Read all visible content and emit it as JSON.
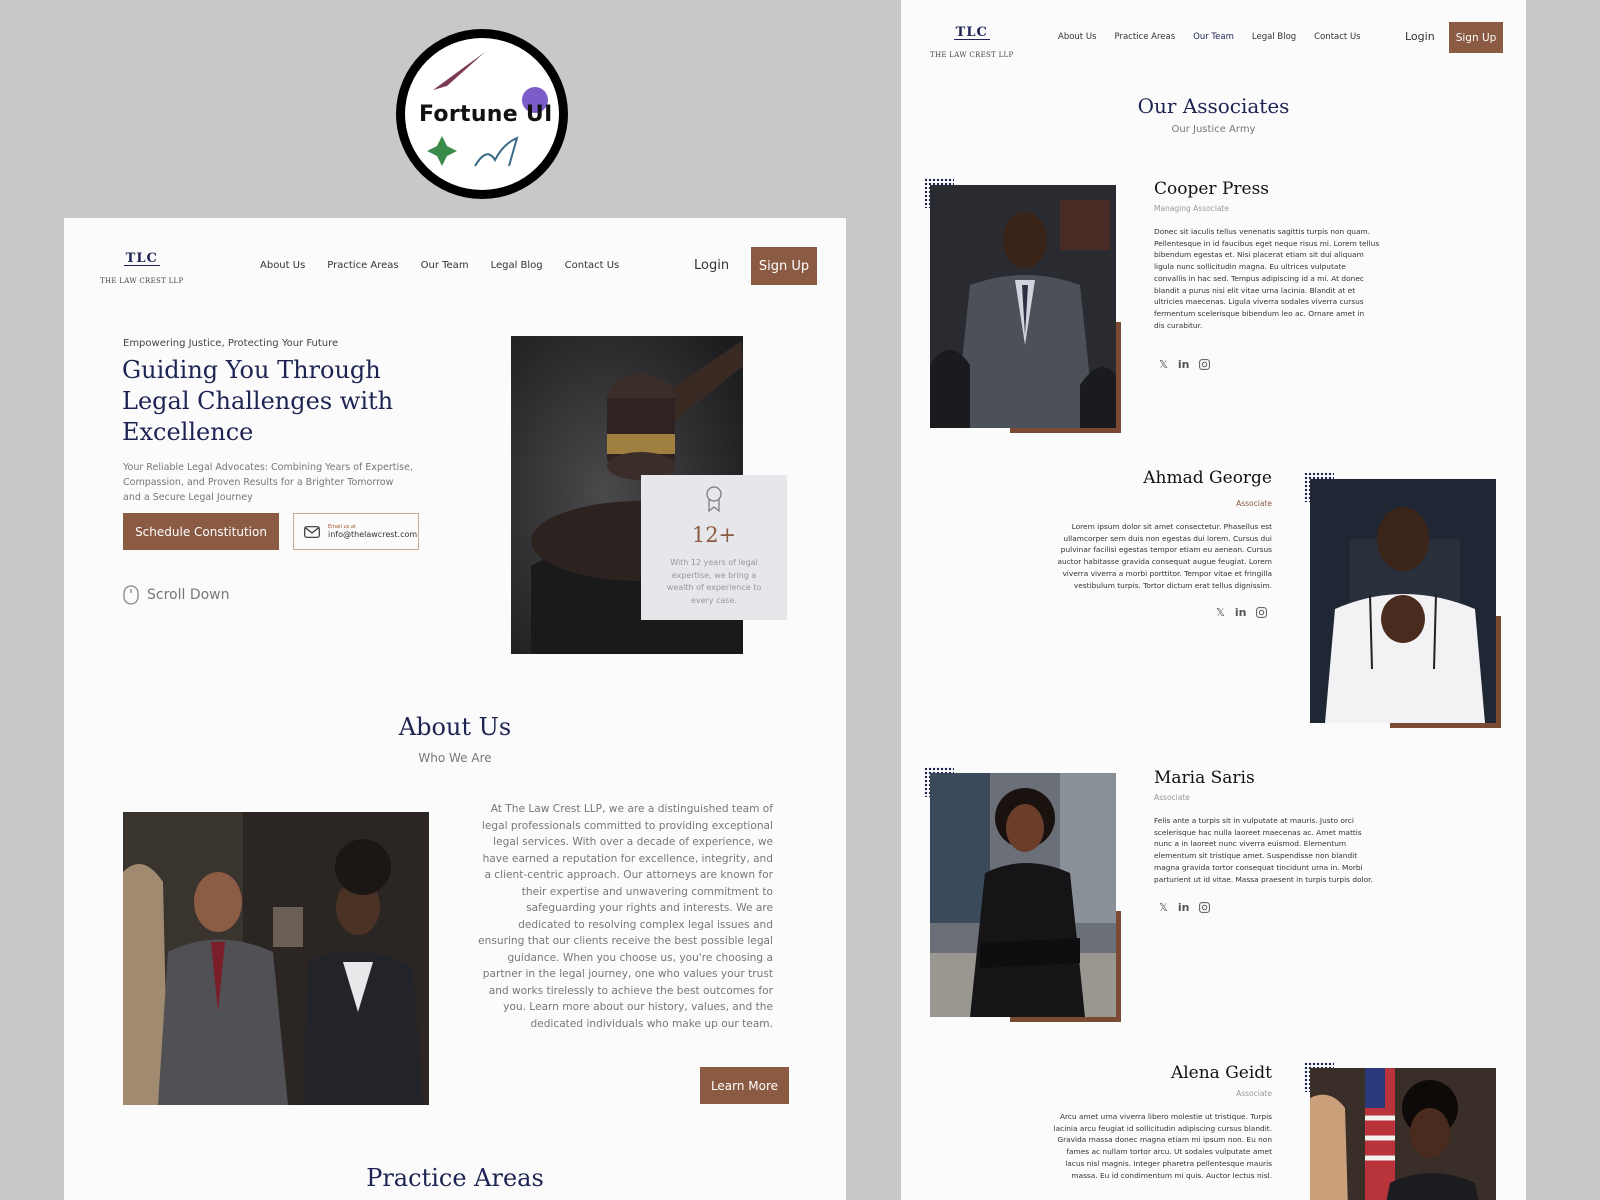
{
  "badge": {
    "text": "Fortune UI"
  },
  "left": {
    "logo": {
      "mono": "TLC",
      "firm": "THE LAW CREST LLP"
    },
    "nav": [
      "About Us",
      "Practice Areas",
      "Our Team",
      "Legal Blog",
      "Contact Us"
    ],
    "login": "Login",
    "signup": "Sign Up",
    "hero": {
      "eyebrow": "Empowering Justice, Protecting Your Future",
      "title_lines": [
        "Guiding You Through",
        "Legal Challenges with",
        "Excellence"
      ],
      "desc_lines": [
        "Your Reliable Legal Advocates: Combining Years of Expertise,",
        "Compassion, and Proven Results for a Brighter Tomorrow",
        "and a Secure Legal Journey"
      ],
      "cta": "Schedule Constitution",
      "email_label": "Email us at",
      "email": "info@thelawcrest.com",
      "scroll": "Scroll Down",
      "stat_value": "12+",
      "stat_lines": [
        "With 12 years of legal",
        "expertise, we bring a",
        "wealth of experience to",
        "every case."
      ]
    },
    "about": {
      "title": "About Us",
      "subtitle": "Who We Are",
      "lines": [
        "At The Law Crest LLP, we are a distinguished team of",
        "legal professionals committed to providing exceptional",
        "legal services. With over a decade of experience, we",
        "have earned a reputation for excellence, integrity, and",
        "a client-centric approach. Our attorneys are known for",
        "their expertise and unwavering commitment to",
        "safeguarding your rights and interests. We are",
        "dedicated to resolving complex legal issues and",
        "ensuring that our clients receive the best possible legal",
        "guidance. When you choose us, you're choosing a",
        "partner in the legal journey, one who values your trust",
        "and works tirelessly to achieve the best outcomes for",
        "you. Learn more about our history, values, and the",
        "dedicated individuals who make up our team."
      ],
      "button": "Learn More"
    },
    "practice_title": "Practice Areas"
  },
  "right": {
    "logo": {
      "mono": "TLC",
      "firm": "THE LAW CREST LLP"
    },
    "nav": [
      "About Us",
      "Practice Areas",
      "Our Team",
      "Legal Blog",
      "Contact Us"
    ],
    "login": "Login",
    "signup": "Sign Up",
    "title": "Our Associates",
    "subtitle": "Our Justice Army",
    "associates": [
      {
        "name": "Cooper Press",
        "role": "Managing Associate",
        "lines": [
          "Donec sit iaculis tellus venenatis sagittis turpis non quam.",
          "Pellentesque in id faucibus eget neque risus mi. Lorem tellus",
          "bibendum egestas et. Nisi placerat etiam sit dui aliquam",
          "ligula nunc sollicitudin magna. Eu ultrices vulputate",
          "convallis in hac sed. Tempus adipiscing id a mi. At donec",
          "blandit a purus nisi elit vitae urna lacinia. Blandit at et",
          "ultricies maecenas. Ligula viverra sodales viverra cursus",
          "fermentum scelerisque bibendum leo ac. Ornare amet in",
          "dis curabitur."
        ]
      },
      {
        "name": "Ahmad George",
        "role": "Associate",
        "lines": [
          "Lorem ipsum dolor sit amet consectetur. Phasellus est",
          "ullamcorper sem duis non egestas dui lorem. Cursus dui",
          "pulvinar facilisi egestas tempor etiam eu aenean. Cursus",
          "auctor habitasse gravida consequat augue feugiat. Lorem",
          "viverra viverra a morbi porttitor. Tempor vitae et fringilla",
          "vestibulum turpis. Tortor dictum erat tellus dignissim."
        ]
      },
      {
        "name": "Maria Saris",
        "role": "Associate",
        "lines": [
          "Felis ante a turpis sit in vulputate at mauris. Justo orci",
          "scelerisque hac nulla laoreet maecenas ac. Amet mattis",
          "nunc a in laoreet nunc viverra euismod. Elementum",
          "elementum sit tristique amet. Suspendisse non blandit",
          "magna gravida tortor consequat tincidunt urna in. Morbi",
          "parturient ut id vitae. Massa praesent in turpis turpis dolor."
        ]
      },
      {
        "name": "Alena Geidt",
        "role": "Associate",
        "lines": [
          "Arcu amet urna viverra libero molestie ut tristique. Turpis",
          "lacinia arcu feugiat id sollicitudin adipiscing cursus blandit.",
          "Gravida massa donec magna etiam mi ipsum non. Eu non",
          "fames ac nullam tortor arcu. Ut sodales vulputate amet",
          "lacus nisl magnis. Integer pharetra pellentesque mauris",
          "massa. Eu id condimentum mi quis. Auctor lectus nisl."
        ]
      }
    ]
  },
  "social_icons": [
    "x-icon",
    "linkedin-icon",
    "instagram-icon"
  ],
  "colors": {
    "navy": "#1d2352",
    "brown": "#8a5a42",
    "page": "#fbfbfb"
  }
}
